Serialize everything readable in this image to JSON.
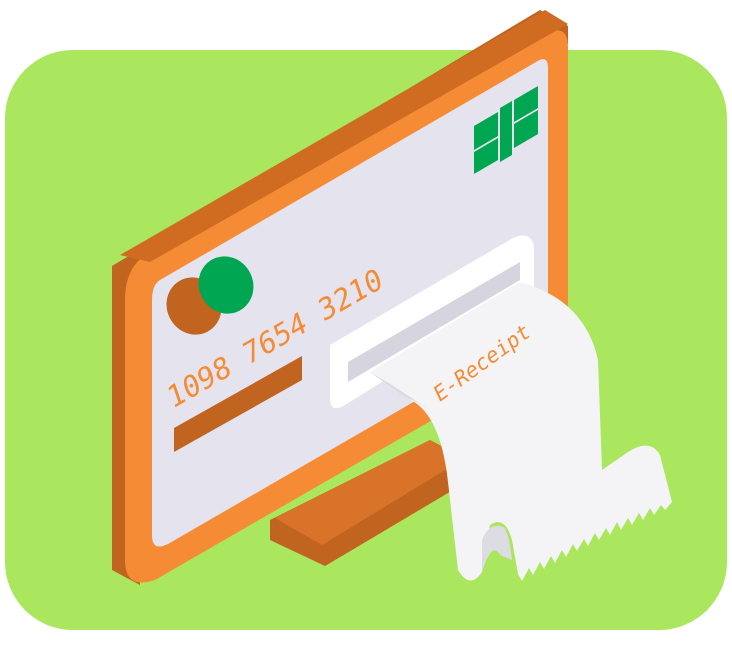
{
  "card": {
    "number": "1098 7654 3210"
  },
  "receipt": {
    "label": "E-Receipt"
  },
  "colors": {
    "background_tile": "#ABE65F",
    "monitor_front": "#F58C35",
    "monitor_side": "#C0641F",
    "screen": "#E5E3EE",
    "chip": "#00A651",
    "paper": "#F4F4F6",
    "paper_shadow": "#DCDCE2",
    "text_orange": "#F58C35"
  },
  "icons": {
    "chip": "card-chip-icon",
    "logo": "card-brand-logo-icon"
  }
}
